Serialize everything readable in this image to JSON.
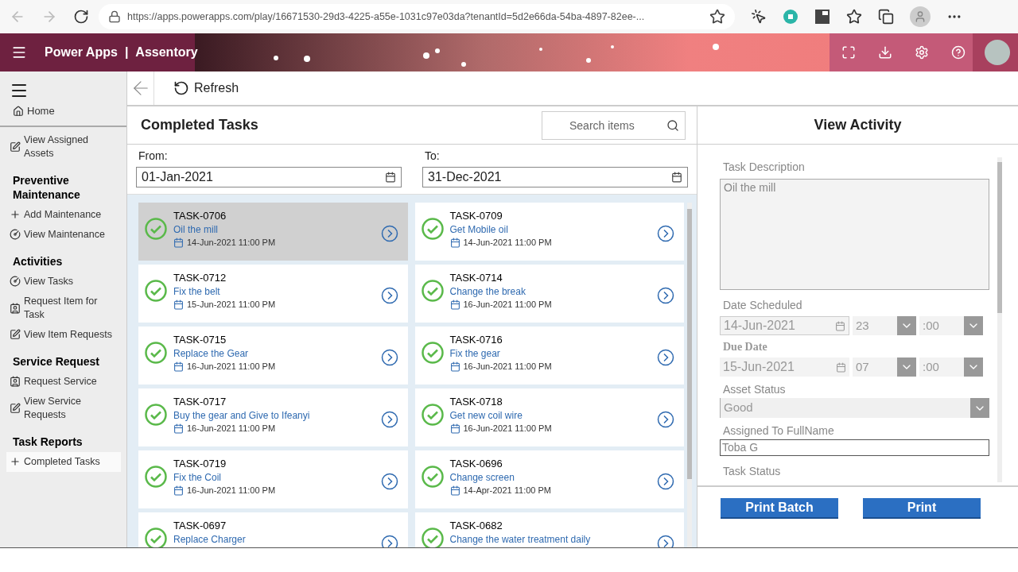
{
  "browser": {
    "url": "https://apps.powerapps.com/play/16671530-29d3-4225-a55e-1031c97e03da?tenantId=5d2e66da-54ba-4897-82ee-..."
  },
  "app_header": {
    "product": "Power Apps",
    "separator": "|",
    "app_name": "Assentory"
  },
  "sidebar": {
    "home": "Home",
    "items": [
      {
        "kind": "edit",
        "label": "View Assigned Assets",
        "selected": false
      },
      {
        "kind": "heading",
        "label": "Preventive Maintenance"
      },
      {
        "kind": "add",
        "label": "Add Maintenance",
        "selected": false
      },
      {
        "kind": "gauge",
        "label": "View Maintenance",
        "selected": false
      },
      {
        "kind": "heading",
        "label": "Activities"
      },
      {
        "kind": "gauge",
        "label": "View Tasks",
        "selected": false
      },
      {
        "kind": "contact",
        "label": "Request Item for Task",
        "selected": false
      },
      {
        "kind": "edit",
        "label": "View Item Requests",
        "selected": false
      },
      {
        "kind": "heading",
        "label": "Service Request"
      },
      {
        "kind": "contact",
        "label": "Request Service",
        "selected": false
      },
      {
        "kind": "edit",
        "label": "View Service Requests",
        "selected": false
      },
      {
        "kind": "heading",
        "label": "Task Reports"
      },
      {
        "kind": "add",
        "label": "Completed Tasks",
        "selected": true
      }
    ]
  },
  "toolbar": {
    "refresh": "Refresh"
  },
  "list_panel": {
    "title": "Completed Tasks",
    "search": {
      "placeholder": "Search items"
    },
    "from_label": "From:",
    "from": "01-Jan-2021",
    "to_label": "To:",
    "to": "31-Dec-2021",
    "tasks": [
      {
        "id": "TASK-0706",
        "description": "Oil the mill",
        "date": "14-Jun-2021 11:00 PM",
        "selected": true
      },
      {
        "id": "TASK-0709",
        "description": "Get Mobile  oil",
        "date": "14-Jun-2021 11:00 PM",
        "selected": false
      },
      {
        "id": "TASK-0712",
        "description": "Fix the belt",
        "date": "15-Jun-2021 11:00 PM",
        "selected": false
      },
      {
        "id": "TASK-0714",
        "description": "Change the break",
        "date": "16-Jun-2021 11:00 PM",
        "selected": false
      },
      {
        "id": "TASK-0715",
        "description": "Replace the Gear",
        "date": "16-Jun-2021 11:00 PM",
        "selected": false
      },
      {
        "id": "TASK-0716",
        "description": "Fix the gear",
        "date": "16-Jun-2021 11:00 PM",
        "selected": false
      },
      {
        "id": "TASK-0717",
        "description": "Buy the gear and Give to Ifeanyi",
        "date": "16-Jun-2021 11:00 PM",
        "selected": false
      },
      {
        "id": "TASK-0718",
        "description": "Get new coil wire",
        "date": "16-Jun-2021 11:00 PM",
        "selected": false
      },
      {
        "id": "TASK-0719",
        "description": "Fix the Coil",
        "date": "16-Jun-2021 11:00 PM",
        "selected": false
      },
      {
        "id": "TASK-0696",
        "description": "Change screen",
        "date": "14-Apr-2021 11:00 PM",
        "selected": false
      },
      {
        "id": "TASK-0697",
        "description": "Replace Charger",
        "selected": false
      },
      {
        "id": "TASK-0682",
        "description": "Change the water treatment daily",
        "selected": false
      }
    ]
  },
  "detail_panel": {
    "title": "View Activity",
    "task_description_label": "Task Description",
    "task_description": "Oil the mill",
    "date_scheduled_label": "Date Scheduled",
    "date_scheduled": "14-Jun-2021",
    "scheduled_hour": "23",
    "scheduled_minute": ":00",
    "due_date_label": "Due Date",
    "due_date": "15-Jun-2021",
    "due_hour": "07",
    "due_minute": ":00",
    "asset_status_label": "Asset Status",
    "asset_status": "Good",
    "assigned_label": "Assigned To FullName",
    "assigned": "Toba G",
    "task_status_label": "Task Status",
    "buttons": [
      "Print Batch",
      "Print"
    ]
  }
}
